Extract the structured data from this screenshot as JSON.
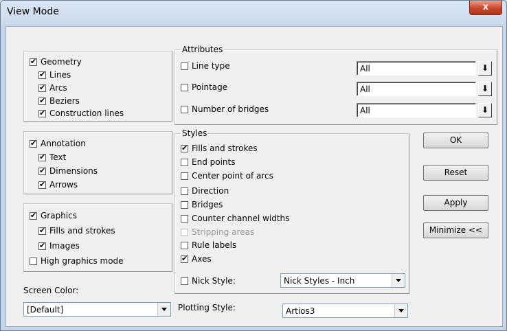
{
  "window": {
    "title": "View Mode",
    "close_label": "x"
  },
  "geometry": {
    "main": "Geometry",
    "items": [
      "Lines",
      "Arcs",
      "Beziers",
      "Construction lines"
    ]
  },
  "annotation": {
    "main": "Annotation",
    "items": [
      "Text",
      "Dimensions",
      "Arrows"
    ]
  },
  "graphics": {
    "main": "Graphics",
    "items": [
      "Fills and strokes",
      "Images"
    ],
    "high_graphics": "High graphics mode"
  },
  "screen_color": {
    "label": "Screen Color:",
    "value": "[Default]"
  },
  "attributes": {
    "legend": "Attributes",
    "line_type": {
      "label": "Line type",
      "value": "All"
    },
    "pointage": {
      "label": "Pointage",
      "value": "All"
    },
    "bridges": {
      "label": "Number of bridges",
      "value": "All"
    }
  },
  "styles": {
    "legend": "Styles",
    "items": [
      "Fills and strokes",
      "End points",
      "Center point of arcs",
      "Direction",
      "Bridges",
      "Counter channel widths",
      "Stripping areas",
      "Rule labels",
      "Axes"
    ],
    "checked": [
      true,
      false,
      false,
      false,
      false,
      false,
      false,
      false,
      true
    ],
    "disabled": [
      false,
      false,
      false,
      false,
      false,
      false,
      true,
      false,
      false
    ],
    "nick_label": "Nick Style:",
    "nick_value": "Nick Styles - Inch"
  },
  "plotting": {
    "label": "Plotting Style:",
    "value": "Artios3"
  },
  "buttons": {
    "ok": "OK",
    "reset": "Reset",
    "apply": "Apply",
    "minimize": "Minimize <<"
  }
}
